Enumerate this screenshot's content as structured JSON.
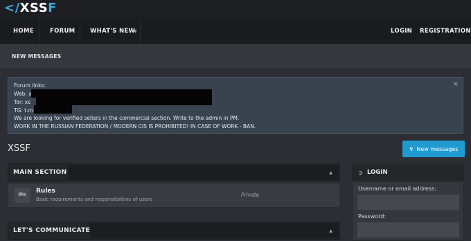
{
  "logo": {
    "part1": "</",
    "part2": "XSS",
    "part3": "F"
  },
  "nav": {
    "home": "HOME",
    "forum": "FORUM",
    "whats_new": "WHAT'S NEW",
    "login": "LOGIN",
    "registration": "REGISTRATION"
  },
  "subnav": {
    "new_messages": "NEW MESSAGES"
  },
  "notice": {
    "lines": [
      "Forum links:",
      "Web: x",
      "Tor: xs",
      "TG: t.m",
      "We are looking for verified sellers in the commercial section. Write to the admin in PM.",
      "WORK IN THE RUSSIAN FEDERATION / MODERN CIS IS PROHIBITED! IN CASE OF WORK - BAN."
    ],
    "close": "×"
  },
  "page": {
    "title": "XSSF",
    "new_messages_button": "New messages"
  },
  "categories": [
    {
      "title": "MAIN SECTION",
      "forums": [
        {
          "title": "Rules",
          "description": "Basic requirements and responsibilities of users",
          "status": "Private"
        }
      ]
    },
    {
      "title": "LET'S COMMUNICATE",
      "forums": []
    }
  ],
  "login_box": {
    "title": "LOGIN",
    "username_label": "Username or email address:",
    "password_label": "Password:",
    "username_value": "",
    "password_value": ""
  },
  "colors": {
    "accent": "#1f9bd1",
    "background": "#2d2e33",
    "notice_background": "#394350"
  },
  "icons": {
    "notice_close": "close-icon",
    "new_messages": "bolt-icon",
    "forum": "chat-bubbles-icon",
    "login": "sign-in-icon",
    "collapse": "caret-up-icon",
    "dropdown": "caret-down-icon"
  }
}
